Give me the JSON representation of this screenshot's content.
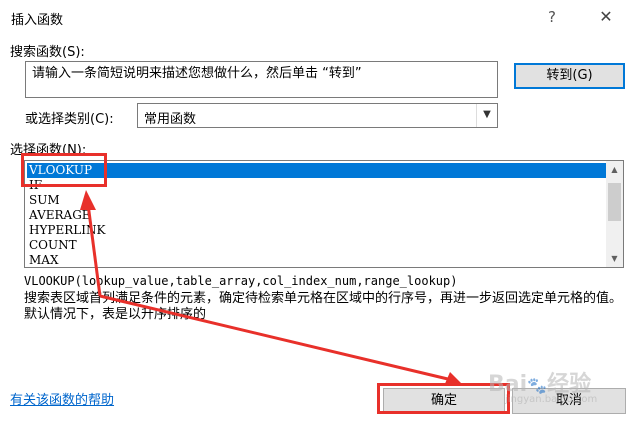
{
  "window": {
    "title": "插入函数",
    "help_glyph": "?",
    "close_glyph": "✕"
  },
  "search": {
    "label": "搜索函数(S):",
    "value": "请输入一条简短说明来描述您想做什么，然后单击 “转到”",
    "goto_label": "转到(G)"
  },
  "category": {
    "label": "或选择类别(C):",
    "selected": "常用函数"
  },
  "functions": {
    "label": "选择函数(N):",
    "items": [
      "VLOOKUP",
      "IF",
      "SUM",
      "AVERAGE",
      "HYPERLINK",
      "COUNT",
      "MAX"
    ],
    "selected_index": 0
  },
  "description": {
    "signature": "VLOOKUP(lookup_value,table_array,col_index_num,range_lookup)",
    "text": "搜索表区域首列满足条件的元素，确定待检索单元格在区域中的行序号，再进一步返回选定单元格的值。默认情况下，表是以升序排序的"
  },
  "footer": {
    "help_link": "有关该函数的帮助",
    "ok_label": "确定",
    "cancel_label": "取消"
  },
  "colors": {
    "selection": "#0078d7",
    "annotation": "#e8302a",
    "link": "#0066cc"
  }
}
